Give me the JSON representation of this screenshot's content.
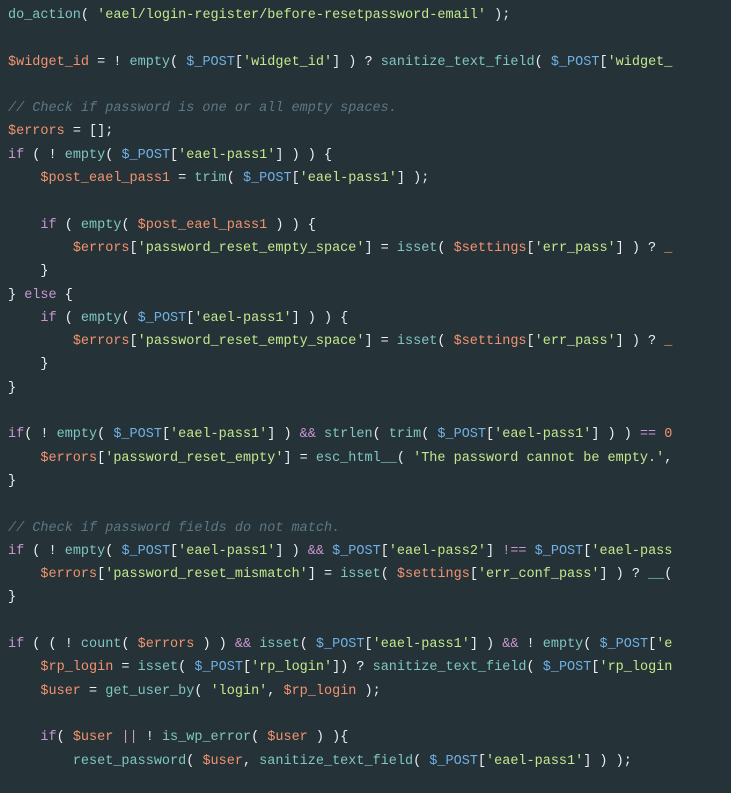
{
  "code": {
    "tokens": [
      [
        [
          "fn",
          "do_action"
        ],
        [
          "var",
          "( "
        ],
        [
          "str",
          "'eael/login-register/before-resetpassword-email'"
        ],
        [
          "var",
          " );"
        ]
      ],
      [],
      [
        [
          "bool",
          "$widget_id"
        ],
        [
          "var",
          " = ! "
        ],
        [
          "fn",
          "empty"
        ],
        [
          "var",
          "( "
        ],
        [
          "glb",
          "$_POST"
        ],
        [
          "var",
          "["
        ],
        [
          "str",
          "'widget_id'"
        ],
        [
          "var",
          "] ) ? "
        ],
        [
          "fn",
          "sanitize_text_field"
        ],
        [
          "var",
          "( "
        ],
        [
          "glb",
          "$_POST"
        ],
        [
          "var",
          "["
        ],
        [
          "str",
          "'widget_"
        ]
      ],
      [],
      [
        [
          "cmt",
          "// Check if password is one or all empty spaces."
        ]
      ],
      [
        [
          "bool",
          "$errors"
        ],
        [
          "var",
          " = [];"
        ]
      ],
      [
        [
          "key",
          "if"
        ],
        [
          "var",
          " ( ! "
        ],
        [
          "fn",
          "empty"
        ],
        [
          "var",
          "( "
        ],
        [
          "glb",
          "$_POST"
        ],
        [
          "var",
          "["
        ],
        [
          "str",
          "'eael-pass1'"
        ],
        [
          "var",
          "] ) ) {"
        ]
      ],
      [
        [
          "var",
          "    "
        ],
        [
          "bool",
          "$post_eael_pass1"
        ],
        [
          "var",
          " = "
        ],
        [
          "fn",
          "trim"
        ],
        [
          "var",
          "( "
        ],
        [
          "glb",
          "$_POST"
        ],
        [
          "var",
          "["
        ],
        [
          "str",
          "'eael-pass1'"
        ],
        [
          "var",
          "] );"
        ]
      ],
      [],
      [
        [
          "var",
          "    "
        ],
        [
          "key",
          "if"
        ],
        [
          "var",
          " ( "
        ],
        [
          "fn",
          "empty"
        ],
        [
          "var",
          "( "
        ],
        [
          "bool",
          "$post_eael_pass1"
        ],
        [
          "var",
          " ) ) {"
        ]
      ],
      [
        [
          "var",
          "        "
        ],
        [
          "bool",
          "$errors"
        ],
        [
          "var",
          "["
        ],
        [
          "str",
          "'password_reset_empty_space'"
        ],
        [
          "var",
          "] = "
        ],
        [
          "fn",
          "isset"
        ],
        [
          "var",
          "( "
        ],
        [
          "bool",
          "$settings"
        ],
        [
          "var",
          "["
        ],
        [
          "str",
          "'err_pass'"
        ],
        [
          "var",
          "] ) ? "
        ],
        [
          "bool",
          "_"
        ]
      ],
      [
        [
          "var",
          "    }"
        ]
      ],
      [
        [
          "var",
          "} "
        ],
        [
          "key",
          "else"
        ],
        [
          "var",
          " {"
        ]
      ],
      [
        [
          "var",
          "    "
        ],
        [
          "key",
          "if"
        ],
        [
          "var",
          " ( "
        ],
        [
          "fn",
          "empty"
        ],
        [
          "var",
          "( "
        ],
        [
          "glb",
          "$_POST"
        ],
        [
          "var",
          "["
        ],
        [
          "str",
          "'eael-pass1'"
        ],
        [
          "var",
          "] ) ) {"
        ]
      ],
      [
        [
          "var",
          "        "
        ],
        [
          "bool",
          "$errors"
        ],
        [
          "var",
          "["
        ],
        [
          "str",
          "'password_reset_empty_space'"
        ],
        [
          "var",
          "] = "
        ],
        [
          "fn",
          "isset"
        ],
        [
          "var",
          "( "
        ],
        [
          "bool",
          "$settings"
        ],
        [
          "var",
          "["
        ],
        [
          "str",
          "'err_pass'"
        ],
        [
          "var",
          "] ) ? "
        ],
        [
          "bool",
          "_"
        ]
      ],
      [
        [
          "var",
          "    }"
        ]
      ],
      [
        [
          "var",
          "}"
        ]
      ],
      [],
      [
        [
          "key",
          "if"
        ],
        [
          "var",
          "( ! "
        ],
        [
          "fn",
          "empty"
        ],
        [
          "var",
          "( "
        ],
        [
          "glb",
          "$_POST"
        ],
        [
          "var",
          "["
        ],
        [
          "str",
          "'eael-pass1'"
        ],
        [
          "var",
          "] ) "
        ],
        [
          "key",
          "&&"
        ],
        [
          "var",
          " "
        ],
        [
          "fn",
          "strlen"
        ],
        [
          "var",
          "( "
        ],
        [
          "fn",
          "trim"
        ],
        [
          "var",
          "( "
        ],
        [
          "glb",
          "$_POST"
        ],
        [
          "var",
          "["
        ],
        [
          "str",
          "'eael-pass1'"
        ],
        [
          "var",
          "] ) ) "
        ],
        [
          "key",
          "=="
        ],
        [
          "var",
          " "
        ],
        [
          "bool",
          "0"
        ]
      ],
      [
        [
          "var",
          "    "
        ],
        [
          "bool",
          "$errors"
        ],
        [
          "var",
          "["
        ],
        [
          "str",
          "'password_reset_empty'"
        ],
        [
          "var",
          "] = "
        ],
        [
          "fn",
          "esc_html__"
        ],
        [
          "var",
          "( "
        ],
        [
          "str",
          "'The password cannot be empty.'"
        ],
        [
          "var",
          ","
        ]
      ],
      [
        [
          "var",
          "}"
        ]
      ],
      [],
      [
        [
          "cmt",
          "// Check if password fields do not match."
        ]
      ],
      [
        [
          "key",
          "if"
        ],
        [
          "var",
          " ( ! "
        ],
        [
          "fn",
          "empty"
        ],
        [
          "var",
          "( "
        ],
        [
          "glb",
          "$_POST"
        ],
        [
          "var",
          "["
        ],
        [
          "str",
          "'eael-pass1'"
        ],
        [
          "var",
          "] ) "
        ],
        [
          "key",
          "&&"
        ],
        [
          "var",
          " "
        ],
        [
          "glb",
          "$_POST"
        ],
        [
          "var",
          "["
        ],
        [
          "str",
          "'eael-pass2'"
        ],
        [
          "var",
          "] "
        ],
        [
          "key",
          "!=="
        ],
        [
          "var",
          " "
        ],
        [
          "glb",
          "$_POST"
        ],
        [
          "var",
          "["
        ],
        [
          "str",
          "'eael-pass"
        ]
      ],
      [
        [
          "var",
          "    "
        ],
        [
          "bool",
          "$errors"
        ],
        [
          "var",
          "["
        ],
        [
          "str",
          "'password_reset_mismatch'"
        ],
        [
          "var",
          "] = "
        ],
        [
          "fn",
          "isset"
        ],
        [
          "var",
          "( "
        ],
        [
          "bool",
          "$settings"
        ],
        [
          "var",
          "["
        ],
        [
          "str",
          "'err_conf_pass'"
        ],
        [
          "var",
          "] ) ? "
        ],
        [
          "fn",
          "__"
        ],
        [
          "var",
          "("
        ]
      ],
      [
        [
          "var",
          "}"
        ]
      ],
      [],
      [
        [
          "key",
          "if"
        ],
        [
          "var",
          " ( ( ! "
        ],
        [
          "fn",
          "count"
        ],
        [
          "var",
          "( "
        ],
        [
          "bool",
          "$errors"
        ],
        [
          "var",
          " ) ) "
        ],
        [
          "key",
          "&&"
        ],
        [
          "var",
          " "
        ],
        [
          "fn",
          "isset"
        ],
        [
          "var",
          "( "
        ],
        [
          "glb",
          "$_POST"
        ],
        [
          "var",
          "["
        ],
        [
          "str",
          "'eael-pass1'"
        ],
        [
          "var",
          "] ) "
        ],
        [
          "key",
          "&&"
        ],
        [
          "var",
          " ! "
        ],
        [
          "fn",
          "empty"
        ],
        [
          "var",
          "( "
        ],
        [
          "glb",
          "$_POST"
        ],
        [
          "var",
          "["
        ],
        [
          "str",
          "'e"
        ]
      ],
      [
        [
          "var",
          "    "
        ],
        [
          "bool",
          "$rp_login"
        ],
        [
          "var",
          " = "
        ],
        [
          "fn",
          "isset"
        ],
        [
          "var",
          "( "
        ],
        [
          "glb",
          "$_POST"
        ],
        [
          "var",
          "["
        ],
        [
          "str",
          "'rp_login'"
        ],
        [
          "var",
          "]) ? "
        ],
        [
          "fn",
          "sanitize_text_field"
        ],
        [
          "var",
          "( "
        ],
        [
          "glb",
          "$_POST"
        ],
        [
          "var",
          "["
        ],
        [
          "str",
          "'rp_login"
        ]
      ],
      [
        [
          "var",
          "    "
        ],
        [
          "bool",
          "$user"
        ],
        [
          "var",
          " = "
        ],
        [
          "fn",
          "get_user_by"
        ],
        [
          "var",
          "( "
        ],
        [
          "str",
          "'login'"
        ],
        [
          "var",
          ", "
        ],
        [
          "bool",
          "$rp_login"
        ],
        [
          "var",
          " );"
        ]
      ],
      [],
      [
        [
          "var",
          "    "
        ],
        [
          "key",
          "if"
        ],
        [
          "var",
          "( "
        ],
        [
          "bool",
          "$user"
        ],
        [
          "var",
          " "
        ],
        [
          "key",
          "||"
        ],
        [
          "var",
          " ! "
        ],
        [
          "fn",
          "is_wp_error"
        ],
        [
          "var",
          "( "
        ],
        [
          "bool",
          "$user"
        ],
        [
          "var",
          " ) ){"
        ]
      ],
      [
        [
          "var",
          "        "
        ],
        [
          "fn",
          "reset_password"
        ],
        [
          "var",
          "( "
        ],
        [
          "bool",
          "$user"
        ],
        [
          "var",
          ", "
        ],
        [
          "fn",
          "sanitize_text_field"
        ],
        [
          "var",
          "( "
        ],
        [
          "glb",
          "$_POST"
        ],
        [
          "var",
          "["
        ],
        [
          "str",
          "'eael-pass1'"
        ],
        [
          "var",
          "] ) );"
        ]
      ]
    ]
  }
}
